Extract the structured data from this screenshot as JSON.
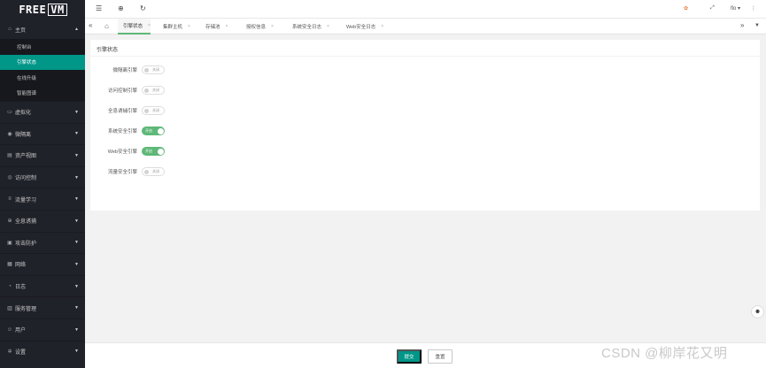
{
  "logo": {
    "left": "FREE",
    "right": "VM"
  },
  "sidebar": {
    "home": {
      "label": "主页",
      "icon": "home-icon"
    },
    "home_items": [
      {
        "label": "控制台",
        "active": false
      },
      {
        "label": "引擎状态",
        "active": true
      },
      {
        "label": "在线升级",
        "active": false
      },
      {
        "label": "智能图谱",
        "active": false
      }
    ],
    "groups": [
      {
        "label": "虚拟化",
        "icon": "vm-icon"
      },
      {
        "label": "微隔离",
        "icon": "shield-icon"
      },
      {
        "label": "资产视图",
        "icon": "asset-icon"
      },
      {
        "label": "访问控制",
        "icon": "access-icon"
      },
      {
        "label": "流量学习",
        "icon": "flow-icon"
      },
      {
        "label": "全息诱捕",
        "icon": "trap-icon"
      },
      {
        "label": "攻击防护",
        "icon": "defense-icon"
      },
      {
        "label": "网络",
        "icon": "network-icon"
      },
      {
        "label": "日志",
        "icon": "eye-icon"
      },
      {
        "label": "服务管理",
        "icon": "service-icon"
      },
      {
        "label": "用户",
        "icon": "user-icon"
      },
      {
        "label": "设置",
        "icon": "gear-icon"
      }
    ]
  },
  "topbar": {
    "user": "flo"
  },
  "tabs": [
    {
      "label": "引擎状态",
      "active": true
    },
    {
      "label": "集群主机",
      "active": false
    },
    {
      "label": "存储池",
      "active": false
    },
    {
      "label": "授权信息",
      "active": false
    },
    {
      "label": "系统安全日志",
      "active": false
    },
    {
      "label": "Web安全日志",
      "active": false
    }
  ],
  "card": {
    "title": "引擎状态",
    "rows": [
      {
        "label": "微隔离引擎",
        "on": false,
        "text": "关闭"
      },
      {
        "label": "访问控制引擎",
        "on": false,
        "text": "关闭"
      },
      {
        "label": "全息诱捕引擎",
        "on": false,
        "text": "关闭"
      },
      {
        "label": "系统安全引擎",
        "on": true,
        "text": "开启"
      },
      {
        "label": "Web安全引擎",
        "on": true,
        "text": "开启"
      },
      {
        "label": "流量安全引擎",
        "on": false,
        "text": "关闭"
      }
    ]
  },
  "footer": {
    "submit": "提交",
    "reset": "重置"
  },
  "watermark": "CSDN @柳岸花又明"
}
